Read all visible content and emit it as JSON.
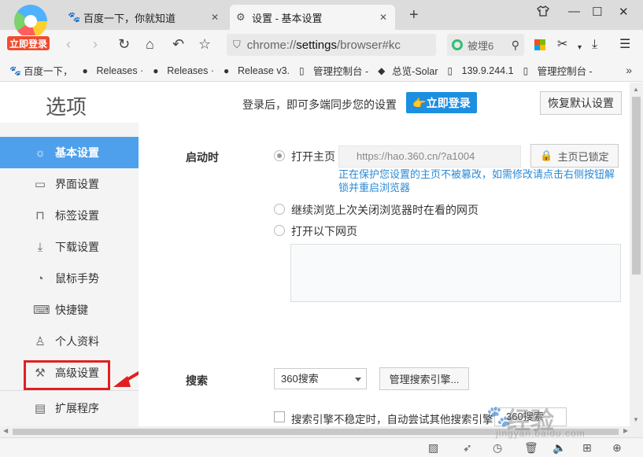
{
  "browser": {
    "login_badge": "立即登录",
    "tabs": [
      {
        "title": "百度一下，你就知道",
        "icon": "paw-icon",
        "active": false
      },
      {
        "title": "设置 - 基本设置",
        "icon": "gear-icon",
        "active": true
      }
    ],
    "address": {
      "prefix": "chrome://",
      "host": "settings",
      "path": "/browser#kc"
    },
    "search": {
      "text": "被埋6"
    },
    "bookmarks": [
      {
        "label": "百度一下，",
        "icon": "paw-icon"
      },
      {
        "label": "Releases ·",
        "icon": "github-icon"
      },
      {
        "label": "Releases ·",
        "icon": "github-icon"
      },
      {
        "label": "Release v3.",
        "icon": "github-icon"
      },
      {
        "label": "管理控制台 -",
        "icon": "page-icon"
      },
      {
        "label": "总览-Solar",
        "icon": "solar-icon"
      },
      {
        "label": "139.9.244.1",
        "icon": "page-icon"
      },
      {
        "label": "管理控制台 -",
        "icon": "page-icon"
      }
    ],
    "bookmarks_more": "»"
  },
  "settings": {
    "title": "选项",
    "sync_text": "登录后，即可多端同步您的设置",
    "login_button": "👉立即登录",
    "reset_button": "恢复默认设置",
    "sidebar": [
      {
        "label": "基本设置",
        "icon": "gear-icon",
        "active": true
      },
      {
        "label": "界面设置",
        "icon": "window-icon",
        "active": false
      },
      {
        "label": "标签设置",
        "icon": "tab-icon",
        "active": false
      },
      {
        "label": "下载设置",
        "icon": "download-icon",
        "active": false
      },
      {
        "label": "鼠标手势",
        "icon": "mouse-icon",
        "active": false
      },
      {
        "label": "快捷键",
        "icon": "keyboard-icon",
        "active": false
      },
      {
        "label": "个人资料",
        "icon": "person-icon",
        "active": false
      },
      {
        "label": "高级设置",
        "icon": "wrench-icon",
        "active": false
      },
      {
        "label": "扩展程序",
        "icon": "extension-icon",
        "active": false
      }
    ],
    "startup": {
      "label": "启动时",
      "option_home": "打开主页",
      "home_url": "https://hao.360.cn/?a1004",
      "lock_button": "主页已锁定",
      "notice": "正在保护您设置的主页不被篡改，如需修改请点击右侧按钮解锁并重启浏览器",
      "option_continue": "继续浏览上次关闭浏览器时在看的网页",
      "option_pages": "打开以下网页"
    },
    "search": {
      "label": "搜索",
      "engine": "360搜索",
      "manage_button": "管理搜索引擎...",
      "fallback_text": "搜索引擎不稳定时，自动尝试其他搜索引擎：",
      "fallback_engine": "360搜索"
    }
  },
  "watermark": {
    "text": "经验",
    "url": "jingyan.baidu.com"
  },
  "colors": {
    "accent": "#4ea0ec",
    "login_button": "#1d8fe1",
    "notice": "#2b8ad6",
    "highlight": "#e02020"
  }
}
